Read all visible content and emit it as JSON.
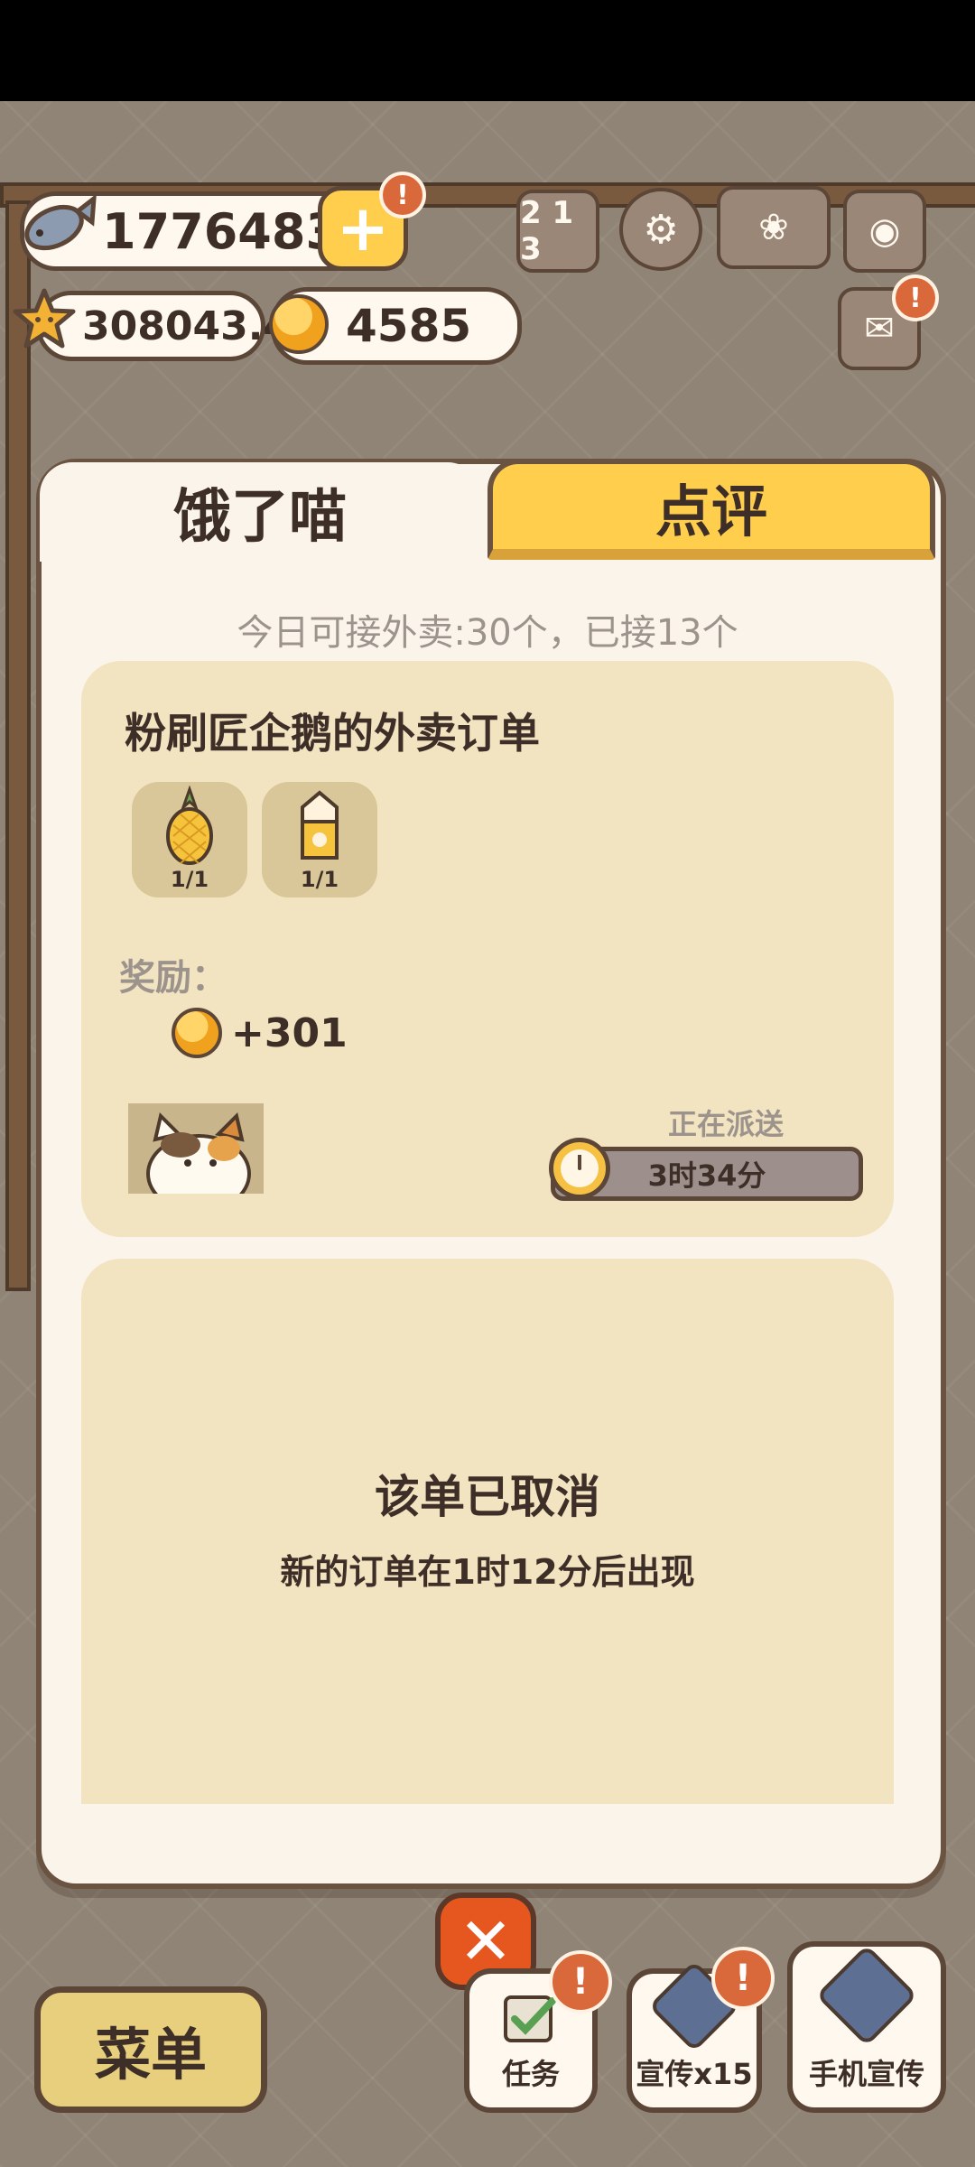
{
  "hud": {
    "fish": "17764837",
    "stars": "308043.4",
    "bells": "4585"
  },
  "icons": {
    "fish": "fish-icon",
    "plus": "plus-icon",
    "star": "star-icon",
    "bell": "bell-coin-icon",
    "ranking": "ranking-icon",
    "settings": "gear-icon",
    "album": "paw-book-icon",
    "camera": "camera-icon",
    "mail": "mail-icon"
  },
  "dialog": {
    "tabs": [
      "饿了喵",
      "点评"
    ],
    "quota": "今日可接外卖:30个，已接13个",
    "order": {
      "title": "粉刷匠企鹅的外卖订单",
      "items": [
        {
          "icon": "pineapple-icon",
          "qty": "1/1"
        },
        {
          "icon": "milk-carton-icon",
          "qty": "1/1"
        }
      ],
      "reward_label": "奖励：",
      "reward_value": "+301",
      "status": "正在派送",
      "time": "3时34分"
    },
    "cancelled": {
      "title": "该单已取消",
      "subtitle": "新的订单在1时12分后出现"
    }
  },
  "bottom": {
    "menu": "菜单",
    "tasks": "任务",
    "promo": "宣传x15",
    "phone_promo": "手机宣传",
    "close_symbol": "✕",
    "alert_symbol": "!"
  },
  "colors": {
    "accent_yellow": "#ffce4d",
    "close_orange": "#e5571f",
    "card_bg": "#f2e3c1",
    "dialog_bg": "#fbf4ea"
  }
}
